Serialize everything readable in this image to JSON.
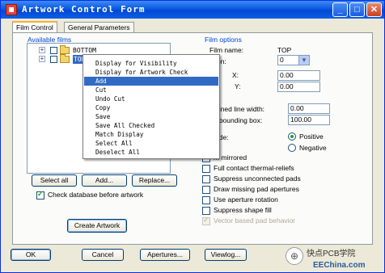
{
  "window": {
    "title": "Artwork Control Form",
    "minimize_glyph": "_",
    "maximize_glyph": "□",
    "close_glyph": "✕"
  },
  "tabs": [
    {
      "label": "Film Control",
      "active": true
    },
    {
      "label": "General Parameters",
      "active": false
    }
  ],
  "available_films": {
    "group_label": "Available films",
    "tree": [
      {
        "label": "BOTTOM",
        "expander": "+"
      },
      {
        "label": "TOP",
        "expander": "+"
      }
    ],
    "buttons": {
      "select_all": "Select all",
      "add": "Add...",
      "replace": "Replace..."
    },
    "check_database_label": "Check database before artwork",
    "check_database_checked": true,
    "create_artwork_label": "Create Artwork"
  },
  "context_menu": {
    "items": [
      "Display for Visibility",
      "Display for Artwork Check",
      "Add",
      "Cut",
      "Undo Cut",
      "Copy",
      "Save",
      "Save All Checked",
      "Match Display",
      "Select All",
      "Deselect All"
    ],
    "highlighted_index": 2
  },
  "film_options": {
    "group_label": "Film options",
    "film_name_label": "Film name:",
    "film_name_value": "TOP",
    "rotation_label": "ation:",
    "rotation_value": "0",
    "offset_label": "et",
    "offset_x_label": "X:",
    "offset_x_value": "0.00",
    "offset_y_label": "Y:",
    "offset_y_value": "0.00",
    "undefined_line_width_label": "defined line width:",
    "undefined_line_width_value": "0.00",
    "shape_bounding_box_label": "pe bounding box:",
    "shape_bounding_box_value": "100.00",
    "plot_mode_label": "mode:",
    "positive_label": "Positive",
    "negative_label": "Negative",
    "plot_mode_value": "Positive",
    "checkboxes": [
      {
        "label": "m mirrored",
        "checked": false,
        "enabled": true
      },
      {
        "label": "Full contact thermal-reliefs",
        "checked": false,
        "enabled": true
      },
      {
        "label": "Suppress unconnected pads",
        "checked": false,
        "enabled": true
      },
      {
        "label": "Draw missing pad apertures",
        "checked": false,
        "enabled": true
      },
      {
        "label": "Use aperture rotation",
        "checked": false,
        "enabled": true
      },
      {
        "label": "Suppress shape fill",
        "checked": false,
        "enabled": true
      },
      {
        "label": "Vector based pad behavior",
        "checked": true,
        "enabled": false
      }
    ]
  },
  "footer_buttons": {
    "ok": "OK",
    "cancel": "Cancel",
    "apertures": "Apertures...",
    "viewlog": "Viewlog..."
  },
  "watermark": {
    "title": "快点PCB学院",
    "site": "EEChina.com",
    "badge_glyph": "⊕"
  }
}
